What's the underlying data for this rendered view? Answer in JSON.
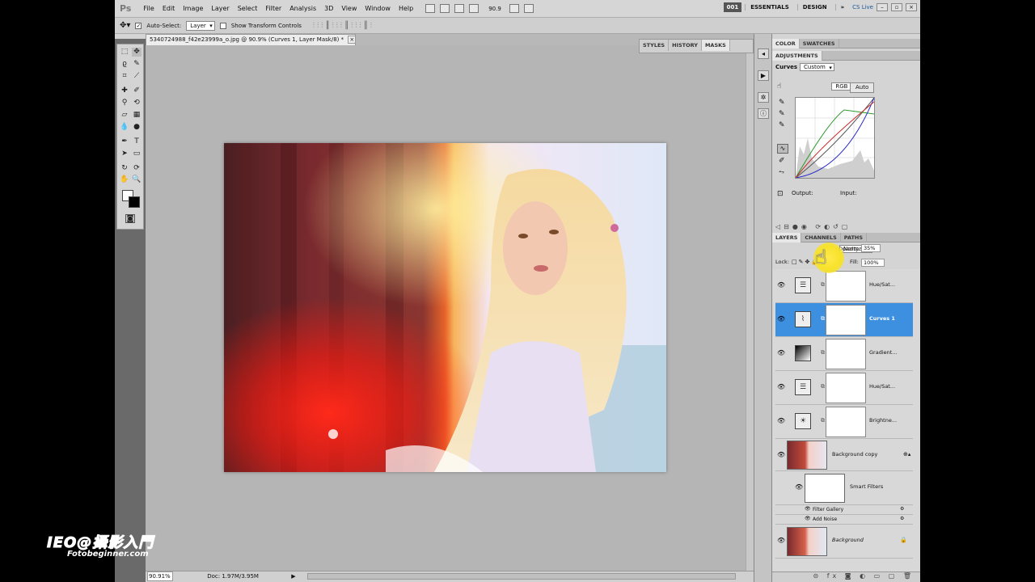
{
  "menubar": {
    "logo": "Ps",
    "items": [
      "File",
      "Edit",
      "Image",
      "Layer",
      "Select",
      "Filter",
      "Analysis",
      "3D",
      "View",
      "Window",
      "Help"
    ],
    "zoom": "90.9",
    "workspace_num": "001",
    "workspaces": [
      "ESSENTIALS",
      "DESIGN"
    ],
    "more": "»",
    "cslive": "CS Live"
  },
  "options": {
    "auto_select_label": "Auto-Select:",
    "auto_select_value": "Layer",
    "show_transform": "Show Transform Controls"
  },
  "document": {
    "tab_title": "5340724988_f42e23999a_o.jpg @ 90.9% (Curves 1, Layer Mask/8) *",
    "zoom": "90.91%",
    "doc_size": "Doc: 1.97M/3.95M"
  },
  "float_panel": {
    "tabs": [
      "STYLES",
      "HISTORY",
      "MASKS"
    ],
    "active": "MASKS"
  },
  "color_panel": {
    "tabs": [
      "COLOR",
      "SWATCHES"
    ]
  },
  "adjustments": {
    "title": "ADJUSTMENTS",
    "type_label": "Curves",
    "preset": "Custom",
    "channel": "RGB",
    "auto_label": "Auto",
    "output_label": "Output:",
    "input_label": "Input:"
  },
  "layers_panel": {
    "tabs": [
      "LAYERS",
      "CHANNELS",
      "PATHS"
    ],
    "blend_mode": "Normal",
    "opacity_label": "Opacity:",
    "opacity": "35%",
    "lock_label": "Lock:",
    "fill_label": "Fill:",
    "fill": "100%",
    "layers": [
      {
        "name": "Hue/Sat...",
        "icon": "hue-sat-icon"
      },
      {
        "name": "Curves 1",
        "icon": "curves-icon",
        "selected": true
      },
      {
        "name": "Gradient...",
        "icon": "gradient-icon"
      },
      {
        "name": "Hue/Sat...",
        "icon": "hue-sat-icon"
      },
      {
        "name": "Brightne...",
        "icon": "brightness-icon"
      }
    ],
    "bg_copy": "Background copy",
    "smart_filters": "Smart Filters",
    "filters": [
      "Filter Gallery",
      "Add Noise"
    ],
    "background": "Background"
  },
  "watermark": {
    "line1": "IEO@攝影入門",
    "line2": "Fotobeginner.com"
  },
  "colors": {
    "selected": "#3d8fe0",
    "ui": "#d4d4d4"
  }
}
